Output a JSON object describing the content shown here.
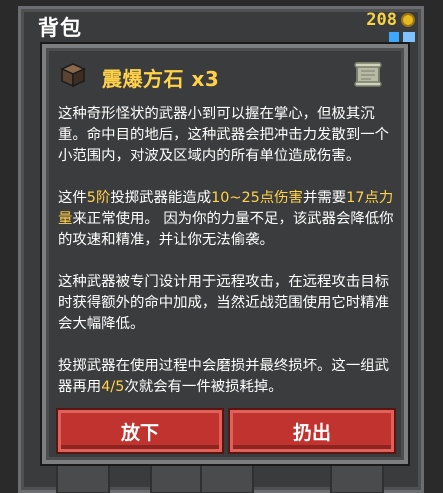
{
  "window": {
    "title": "背包",
    "gold": "208"
  },
  "item": {
    "name": "震爆方石 x3",
    "icon": "stone-cube-icon",
    "info_icon": "scroll-icon"
  },
  "description": {
    "p1": "这种奇形怪状的武器小到可以握在掌心，但极其沉重。命中目的地后，这种武器会把冲击力发散到一个小范围内，对波及区域内的所有单位造成伤害。",
    "p2_a": "这件",
    "p2_tier": "5阶",
    "p2_b": "投掷武器能造成",
    "p2_dmg": "10~25点伤害",
    "p2_c": "并需要",
    "p2_str": "17点力量",
    "p2_d": "来正常使用。 因为你的力量不足，该武器会降低你的攻速和精准，并让你无法偷袭。",
    "p3": "这种武器被专门设计用于远程攻击，在远程攻击目标时获得额外的命中加成，当然近战范围使用它时精准会大幅降低。",
    "p4_a": "投掷武器在使用过程中会磨损并最终损坏。这一组武器再用",
    "p4_uses": "4/5",
    "p4_b": "次就会有一件被损耗掉。"
  },
  "buttons": {
    "drop": "放下",
    "throw": "扔出"
  },
  "colors": {
    "highlight": "#ffd24a",
    "button": "#c0332f",
    "panel": "#3b3c3d"
  }
}
